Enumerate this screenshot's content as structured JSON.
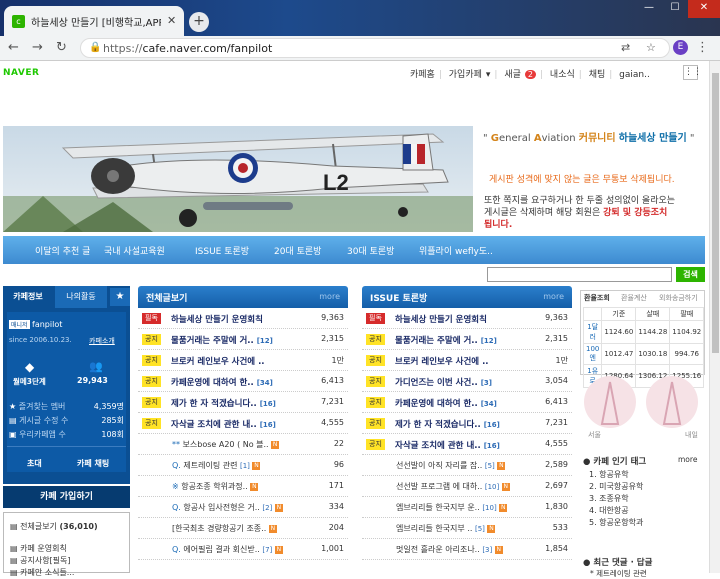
{
  "browser": {
    "tab_title": "하늘세상 만들기 [비행학교,APP",
    "tab_close": "✕",
    "new_tab": "+",
    "url_scheme": "https://",
    "url_rest": "cafe.naver.com/fanpilot",
    "profile_letter": "E",
    "window_controls": [
      "—",
      "☐",
      "✕"
    ]
  },
  "naver": {
    "logo": "NAVER",
    "gnb": {
      "cafe_home": "카페홈",
      "joined_cafe": "가입카페",
      "news": "새글",
      "news_count": "2",
      "feed": "내소식",
      "chat": "채팅",
      "user": "gaian.."
    }
  },
  "banner": {
    "title_quote_open": "\"",
    "title_g": "G",
    "title_eneral": "eneral ",
    "title_a": "A",
    "title_viation": "viation ",
    "title_community": "커뮤니티",
    "title_cafe": "하늘세상 만들기",
    "title_quote_close": "\"",
    "notice": "게시판 성격에 맞지 않는 글은 무통보 삭제됩니다.",
    "warn_line1": "또한 쪽지를 요구하거나 한 두줄 성의없이 올라오는",
    "warn_line2a": "게시글은 삭제하며 해당 회원은 ",
    "warn_red": "강퇴 및 강등조치",
    "warn_line3": "됩니다.",
    "plane_code": "L2"
  },
  "menubar": [
    "이달의 추천 글",
    "국내 사설교육원",
    "ISSUE 토론방",
    "20대 토론방",
    "30대 토론방",
    "위플라이 wefly도.."
  ],
  "search": {
    "button": "검색",
    "placeholder": ""
  },
  "left": {
    "tab_info": "카페정보",
    "tab_activity": "나의활동",
    "tab_star": "★",
    "manager_badge": "매니저",
    "manager_name": "fanpilot",
    "since": "since 2006.10.23.",
    "intro": "카페소개",
    "grade": "월메3단계",
    "members": "29,943",
    "stats": [
      {
        "label": "즐겨찾는 멤버",
        "value": "4,359명"
      },
      {
        "label": "게시글 수정 수",
        "value": "285회"
      },
      {
        "label": "우리카페앱 수",
        "value": "108회"
      }
    ],
    "invite": "초대",
    "cafe_chat": "카페 채팅",
    "join": "카페 가입하기",
    "menu": [
      {
        "label": "전체글보기",
        "count": "(36,010)"
      },
      {
        "label": "카페 운영회칙"
      },
      {
        "label": "공지사항[필독]"
      },
      {
        "label": "카페안 소식들..."
      }
    ]
  },
  "board_all": {
    "title": "전체글보기",
    "more": "more",
    "rows": [
      {
        "tag": "필독",
        "tag_type": "red",
        "title": "하늘세상 만들기 운영회칙",
        "count": "9,363"
      },
      {
        "tag": "공지",
        "tag_type": "yel",
        "title": "물품거래는 주말에 거..",
        "comments": "[12]",
        "count": "2,315"
      },
      {
        "tag": "공지",
        "tag_type": "yel",
        "title": "브로커 레인보우 사건에 ..",
        "count": "1만"
      },
      {
        "tag": "공지",
        "tag_type": "yel",
        "title": "카페운영에 대하여 한..",
        "comments": "[34]",
        "count": "6,413"
      },
      {
        "tag": "공지",
        "tag_type": "yel",
        "title": "제가 한 자 적겠습니다..",
        "comments": "[16]",
        "count": "7,231"
      },
      {
        "tag": "공지",
        "tag_type": "yel",
        "title": "자삭글 조치에 관한 내..",
        "comments": "[16]",
        "count": "4,555"
      },
      {
        "prefix": "**",
        "title": "보스bose A20 ( No 블..",
        "count": "22"
      },
      {
        "prefix": "Q.",
        "title": "제트레이팅 관련",
        "comments": "[1]",
        "count": "96"
      },
      {
        "prefix": "※",
        "title": "항공조종 학위과정..",
        "count": "171"
      },
      {
        "prefix": "Q.",
        "title": "항공사 입사전형은 거..",
        "comments": "[2]",
        "count": "334"
      },
      {
        "prefix": "",
        "title": "[한국최초 경량항공기 조종..",
        "count": "204"
      },
      {
        "prefix": "Q.",
        "title": "에어필립 결과 회신받..",
        "comments": "[7]",
        "count": "1,001"
      }
    ]
  },
  "board_issue": {
    "title": "ISSUE 토론방",
    "more": "more",
    "rows": [
      {
        "tag": "필독",
        "tag_type": "red",
        "title": "하늘세상 만들기 운영회칙",
        "count": "9,363"
      },
      {
        "tag": "공지",
        "tag_type": "yel",
        "title": "물품거래는 주말에 거..",
        "comments": "[12]",
        "count": "2,315"
      },
      {
        "tag": "공지",
        "tag_type": "yel",
        "title": "브로커 레인보우 사건에 ..",
        "count": "1만"
      },
      {
        "tag": "공지",
        "tag_type": "yel",
        "title": "가디언즈는 이번 사건..",
        "comments": "[3]",
        "count": "3,054"
      },
      {
        "tag": "공지",
        "tag_type": "yel",
        "title": "카페운영에 대하여 한..",
        "comments": "[34]",
        "count": "6,413"
      },
      {
        "tag": "공지",
        "tag_type": "yel",
        "title": "제가 한 자 적겠습니다..",
        "comments": "[16]",
        "count": "7,231"
      },
      {
        "tag": "공지",
        "tag_type": "yel",
        "title": "자삭글 조치에 관한 내..",
        "comments": "[16]",
        "count": "4,555"
      },
      {
        "title": "선선발이 아직 자리를 잡..",
        "comments": "[5]",
        "count": "2,589"
      },
      {
        "title": "선선발 프로그램 에 대하..",
        "comments": "[10]",
        "count": "2,697"
      },
      {
        "title": "엠브리리들 한국지부 운..",
        "comments": "[10]",
        "count": "1,830"
      },
      {
        "title": "엠브리리들 한국지부 ..",
        "comments": "[5]",
        "count": "533"
      },
      {
        "title": "멋일전 흘라운 아리조나..",
        "comments": "[3]",
        "count": "1,854"
      }
    ]
  },
  "exchange": {
    "tabs": [
      "환율조회",
      "환율계산",
      "외화송금하기"
    ],
    "headers": [
      "",
      "기준",
      "살때",
      "팔때"
    ],
    "rows": [
      [
        "1달러",
        "1124.60",
        "1144.28",
        "1104.92"
      ],
      [
        "100엔",
        "1012.47",
        "1030.18",
        "994.76"
      ],
      [
        "1유로",
        "1280.64",
        "1306.12",
        "1255.16"
      ]
    ],
    "day_labels": [
      "서울",
      "내일"
    ]
  },
  "popular": {
    "title": "카페 인기 태그",
    "more": "more",
    "items": [
      "1. 항공유학",
      "2. 미국항공유학",
      "3. 조종유학",
      "4. 대한항공",
      "5. 항공운항학과"
    ]
  },
  "recent": {
    "title": "최근 댓글 · 답글",
    "first": "* 제트레이팅 관련"
  },
  "colors": {
    "naver_green": "#1ec800",
    "cafe_blue": "#1a6ab6",
    "notice_red": "#d62b2b",
    "notice_yellow": "#ffe326"
  }
}
